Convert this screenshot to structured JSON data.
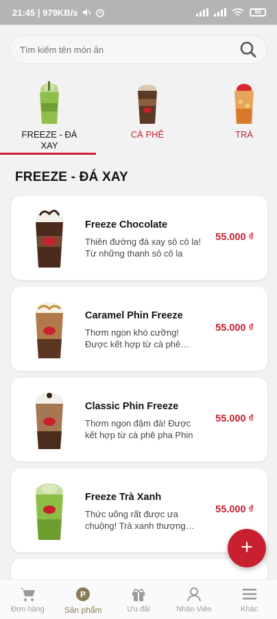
{
  "status_bar": {
    "time_speed": "21:45 | 979KB/s",
    "battery": "99"
  },
  "search": {
    "placeholder": "Tìm kiếm tên món ăn",
    "icon": "search-icon"
  },
  "tabs": [
    {
      "label": "FREEZE - ĐÁ XAY",
      "active": true,
      "icon": "freeze-cup-icon"
    },
    {
      "label": "CÀ PHÊ",
      "active": false,
      "icon": "coffee-cup-icon"
    },
    {
      "label": "TRÀ",
      "active": false,
      "icon": "tea-cup-icon"
    }
  ],
  "section_title": "FREEZE - ĐÁ XAY",
  "products": [
    {
      "name": "Freeze Chocolate",
      "description": "Thiên đường đá xay sô cô la! Từ những thanh sô cô la",
      "price": "55.000 ₫",
      "image": "freeze-chocolate-image"
    },
    {
      "name": "Caramel Phin Freeze",
      "description": "Thơm ngon khó cưỡng! Được kết hợp từ cà phê truyền thống",
      "price": "55.000 ₫",
      "image": "caramel-phin-freeze-image"
    },
    {
      "name": "Classic Phin Freeze",
      "description": "Thơm ngon đậm đà! Được kết hợp từ cà phê pha Phin",
      "price": "55.000 ₫",
      "image": "classic-phin-freeze-image"
    },
    {
      "name": "Freeze Trà Xanh",
      "description": "Thức uống rất được ưa chuộng! Trà xanh thượng hạng",
      "price": "55.000 ₫",
      "image": "freeze-tra-xanh-image"
    }
  ],
  "fab": {
    "label": "+"
  },
  "bottom_nav": [
    {
      "label": "Đơn hàng",
      "icon": "cart-icon",
      "active": false
    },
    {
      "label": "Sản phẩm",
      "icon": "product-p-icon",
      "active": true
    },
    {
      "label": "Ưu đãi",
      "icon": "gift-icon",
      "active": false
    },
    {
      "label": "Nhân Viên",
      "icon": "person-icon",
      "active": false
    },
    {
      "label": "Khác",
      "icon": "menu-icon",
      "active": false
    }
  ],
  "colors": {
    "accent_red": "#c8202f",
    "active_nav": "#8b7a55",
    "background": "#f2f2f2"
  }
}
